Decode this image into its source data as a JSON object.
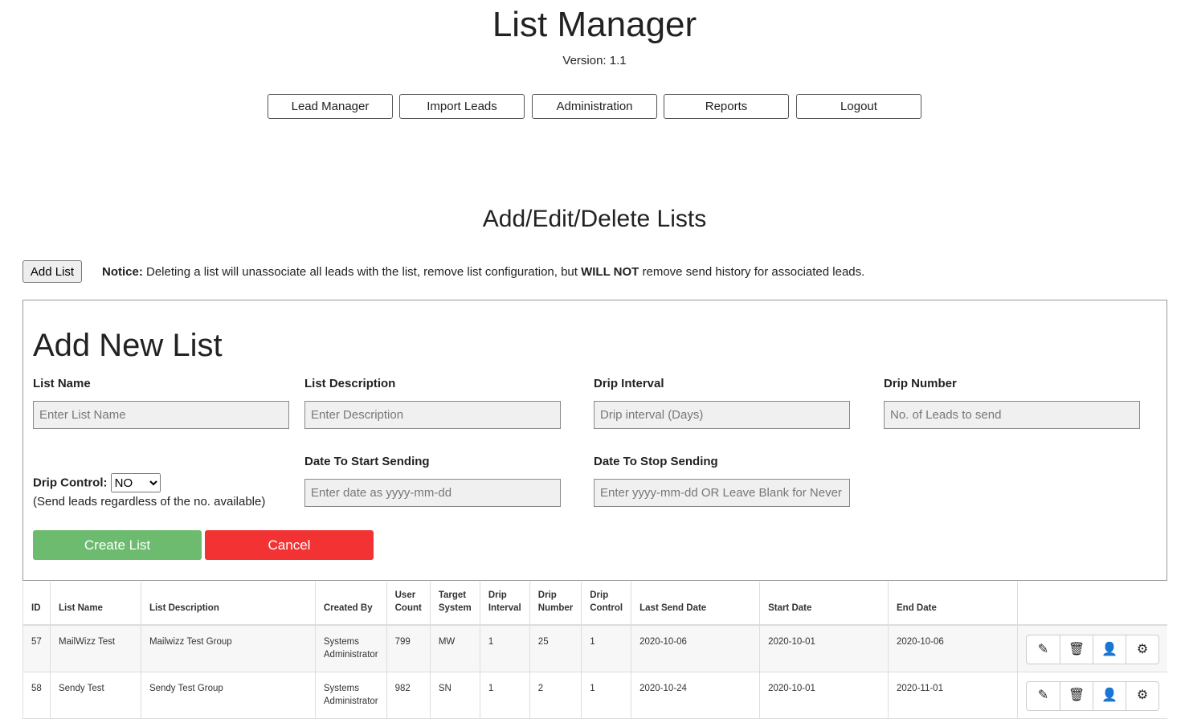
{
  "header": {
    "title": "List Manager",
    "version": "Version: 1.1"
  },
  "nav": [
    "Lead Manager",
    "Import Leads",
    "Administration",
    "Reports",
    "Logout"
  ],
  "section_title": "Add/Edit/Delete Lists",
  "add_list_label": "Add List",
  "notice": {
    "label": "Notice:",
    "text1": " Deleting a list will unassociate all leads with the list, remove list configuration, but ",
    "strong": "WILL NOT",
    "text2": " remove send history for associated leads."
  },
  "form": {
    "title": "Add New List",
    "list_name": {
      "label": "List Name",
      "placeholder": "Enter List Name"
    },
    "list_description": {
      "label": "List Description",
      "placeholder": "Enter Description"
    },
    "drip_interval": {
      "label": "Drip Interval",
      "placeholder": "Drip interval (Days)"
    },
    "drip_number": {
      "label": "Drip Number",
      "placeholder": "No. of Leads to send"
    },
    "drip_control": {
      "label": "Drip Control:",
      "value": "NO",
      "hint": "(Send leads regardless of the no. available)"
    },
    "start_date": {
      "label": "Date To Start Sending",
      "placeholder": "Enter date as yyyy-mm-dd"
    },
    "stop_date": {
      "label": "Date To Stop Sending",
      "placeholder": "Enter yyyy-mm-dd OR Leave Blank for Never"
    },
    "create_label": "Create List",
    "cancel_label": "Cancel"
  },
  "colors": {
    "create": "#6dbb6f",
    "cancel": "#f33333"
  },
  "table": {
    "headers": [
      "ID",
      "List Name",
      "List Description",
      "Created By",
      "User Count",
      "Target System",
      "Drip Interval",
      "Drip Number",
      "Drip Control",
      "Last Send Date",
      "Start Date",
      "End Date"
    ],
    "rows": [
      [
        "57",
        "MailWizz Test",
        "Mailwizz Test Group",
        "Systems Administrator",
        "799",
        "MW",
        "1",
        "25",
        "1",
        "2020-10-06",
        "2020-10-01",
        "2020-10-06"
      ],
      [
        "58",
        "Sendy Test",
        "Sendy Test Group",
        "Systems Administrator",
        "982",
        "SN",
        "1",
        "2",
        "1",
        "2020-10-24",
        "2020-10-01",
        "2020-11-01"
      ]
    ],
    "actions": [
      "pencil-icon",
      "trash-icon",
      "user-icon",
      "gear-icon"
    ]
  }
}
